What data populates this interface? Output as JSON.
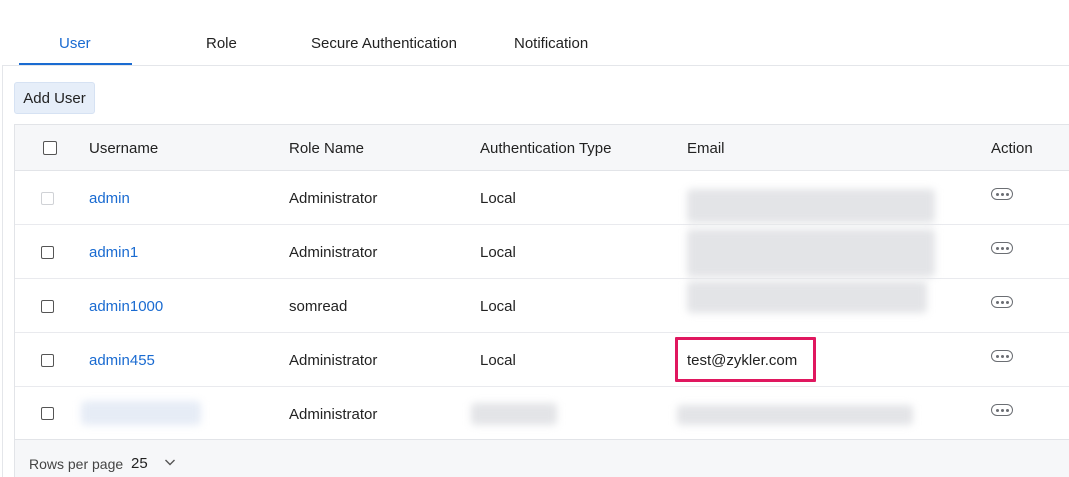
{
  "tabs": [
    {
      "label": "User",
      "active": true
    },
    {
      "label": "Role",
      "active": false
    },
    {
      "label": "Secure Authentication",
      "active": false
    },
    {
      "label": "Notification",
      "active": false
    }
  ],
  "toolbar": {
    "add_user_label": "Add User"
  },
  "table": {
    "headers": [
      "Username",
      "Role Name",
      "Authentication Type",
      "Email",
      "Action"
    ],
    "rows": [
      {
        "username": "admin",
        "role": "Administrator",
        "auth": "Local",
        "email": ""
      },
      {
        "username": "admin1",
        "role": "Administrator",
        "auth": "Local",
        "email": ""
      },
      {
        "username": "admin1000",
        "role": "somread",
        "auth": "Local",
        "email": ""
      },
      {
        "username": "admin455",
        "role": "Administrator",
        "auth": "Local",
        "email": "test@zykler.com"
      },
      {
        "username": "",
        "role": "Administrator",
        "auth": "",
        "email": ""
      }
    ]
  },
  "footer": {
    "rows_per_page_label": "Rows per page",
    "rows_per_page_value": "25"
  },
  "colors": {
    "accent": "#1a6bd1",
    "highlight": "#e0175f"
  }
}
